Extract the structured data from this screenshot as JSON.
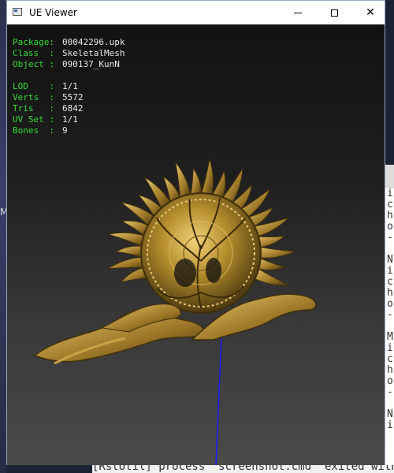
{
  "window": {
    "title": "UE Viewer",
    "minimize_label": "",
    "maximize_label": "",
    "close_label": "✕"
  },
  "info": {
    "package": {
      "label": "Package:",
      "value": "00042296.upk"
    },
    "class": {
      "label": "Class  :",
      "value": "SkeletalMesh"
    },
    "object": {
      "label": "Object :",
      "value": "090137_KunN"
    },
    "lod": {
      "label": "LOD    :",
      "value": "1/1"
    },
    "verts": {
      "label": "Verts  :",
      "value": "5572"
    },
    "tris": {
      "label": "Tris   :",
      "value": "6842"
    },
    "uvset": {
      "label": "UV Set :",
      "value": "1/1"
    },
    "bones": {
      "label": "Bones  :",
      "value": "9"
    }
  },
  "background": {
    "left_text": "M",
    "console_lines": "i\nc\nh\no\n-\n\nN\ni\nc\nh\no\n-\n\nM\ni\nc\nh\no\n-\n\nN\ni",
    "status_text": "[RstUtil] process \"screenshot.cmd\" exited with"
  },
  "colors": {
    "label_green": "#33dd33",
    "value_white": "#e8e8e8",
    "mesh_gold": "#b8902e",
    "bone_blue": "#1a1aff"
  }
}
